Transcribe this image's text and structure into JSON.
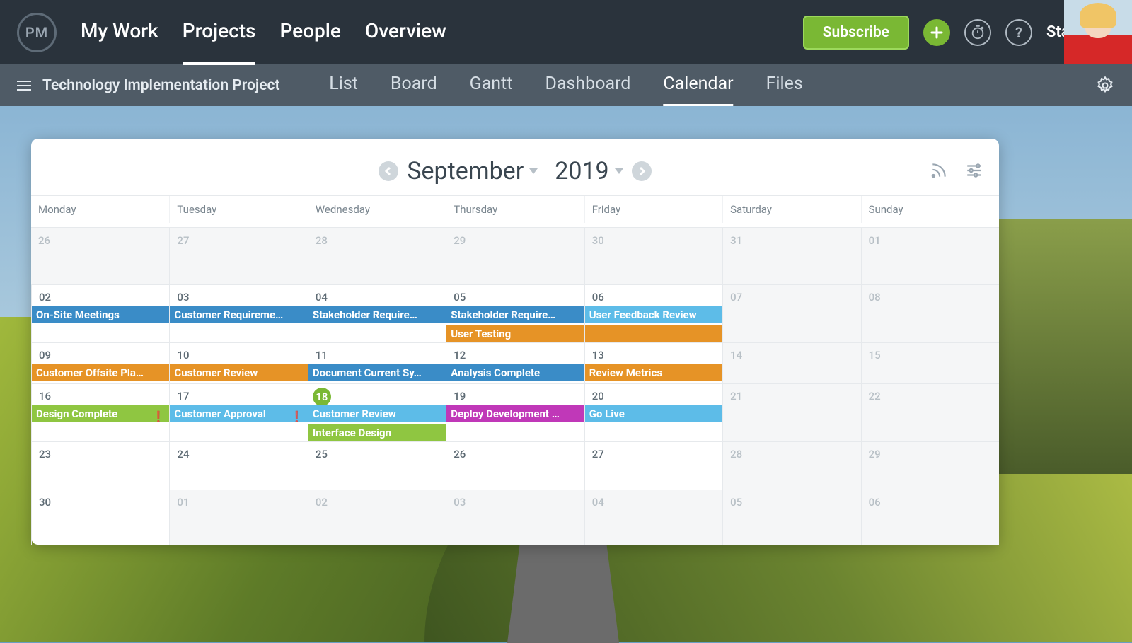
{
  "topnav": {
    "logo": "PM",
    "items": [
      "My Work",
      "Projects",
      "People",
      "Overview"
    ],
    "active_index": 1,
    "subscribe": "Subscribe",
    "user": "Stacy"
  },
  "subnav": {
    "project": "Technology Implementation Project",
    "tabs": [
      "List",
      "Board",
      "Gantt",
      "Dashboard",
      "Calendar",
      "Files"
    ],
    "active_index": 4
  },
  "calendar": {
    "month": "September",
    "year": "2019",
    "dow": [
      "Monday",
      "Tuesday",
      "Wednesday",
      "Thursday",
      "Friday",
      "Saturday",
      "Sunday"
    ],
    "today": "18",
    "weeks": [
      [
        {
          "n": "26",
          "muted": true
        },
        {
          "n": "27",
          "muted": true
        },
        {
          "n": "28",
          "muted": true
        },
        {
          "n": "29",
          "muted": true
        },
        {
          "n": "30",
          "muted": true
        },
        {
          "n": "31",
          "muted": true
        },
        {
          "n": "01",
          "muted": true
        }
      ],
      [
        {
          "n": "02",
          "events": [
            {
              "t": "On-Site Meetings",
              "c": "blue"
            }
          ]
        },
        {
          "n": "03",
          "events": [
            {
              "t": "Customer Requireme…",
              "c": "blue"
            }
          ]
        },
        {
          "n": "04",
          "events": [
            {
              "t": "Stakeholder Require…",
              "c": "blue"
            }
          ]
        },
        {
          "n": "05",
          "events": [
            {
              "t": "Stakeholder Require…",
              "c": "blue"
            },
            {
              "t": "User Testing",
              "c": "orange"
            }
          ]
        },
        {
          "n": "06",
          "events": [
            {
              "t": "User Feedback Review",
              "c": "lblue"
            },
            {
              "t": "",
              "c": "orange"
            }
          ]
        },
        {
          "n": "07",
          "muted": true
        },
        {
          "n": "08",
          "muted": true
        }
      ],
      [
        {
          "n": "09",
          "events": [
            {
              "t": "Customer Offsite Pla…",
              "c": "orange"
            }
          ]
        },
        {
          "n": "10",
          "events": [
            {
              "t": "Customer Review",
              "c": "orange"
            }
          ]
        },
        {
          "n": "11",
          "events": [
            {
              "t": "Document Current Sy…",
              "c": "blue"
            }
          ]
        },
        {
          "n": "12",
          "events": [
            {
              "t": "Analysis Complete",
              "c": "blue"
            }
          ]
        },
        {
          "n": "13",
          "events": [
            {
              "t": "Review Metrics",
              "c": "orange"
            }
          ]
        },
        {
          "n": "14",
          "muted": true
        },
        {
          "n": "15",
          "muted": true
        }
      ],
      [
        {
          "n": "16",
          "events": [
            {
              "t": "Design Complete",
              "c": "green",
              "flag": true
            }
          ]
        },
        {
          "n": "17",
          "events": [
            {
              "t": "Customer Approval",
              "c": "lblue",
              "flag": true
            }
          ]
        },
        {
          "n": "18",
          "today": true,
          "events": [
            {
              "t": "Customer Review",
              "c": "lblue"
            },
            {
              "t": "Interface Design",
              "c": "green"
            }
          ]
        },
        {
          "n": "19",
          "events": [
            {
              "t": "Deploy Development …",
              "c": "magenta"
            }
          ]
        },
        {
          "n": "20",
          "events": [
            {
              "t": "Go Live",
              "c": "lblue"
            }
          ]
        },
        {
          "n": "21",
          "muted": true
        },
        {
          "n": "22",
          "muted": true
        }
      ],
      [
        {
          "n": "23"
        },
        {
          "n": "24"
        },
        {
          "n": "25"
        },
        {
          "n": "26"
        },
        {
          "n": "27"
        },
        {
          "n": "28",
          "muted": true
        },
        {
          "n": "29",
          "muted": true
        }
      ],
      [
        {
          "n": "30"
        },
        {
          "n": "01",
          "muted": true
        },
        {
          "n": "02",
          "muted": true
        },
        {
          "n": "03",
          "muted": true
        },
        {
          "n": "04",
          "muted": true
        },
        {
          "n": "05",
          "muted": true
        },
        {
          "n": "06",
          "muted": true
        }
      ]
    ]
  }
}
